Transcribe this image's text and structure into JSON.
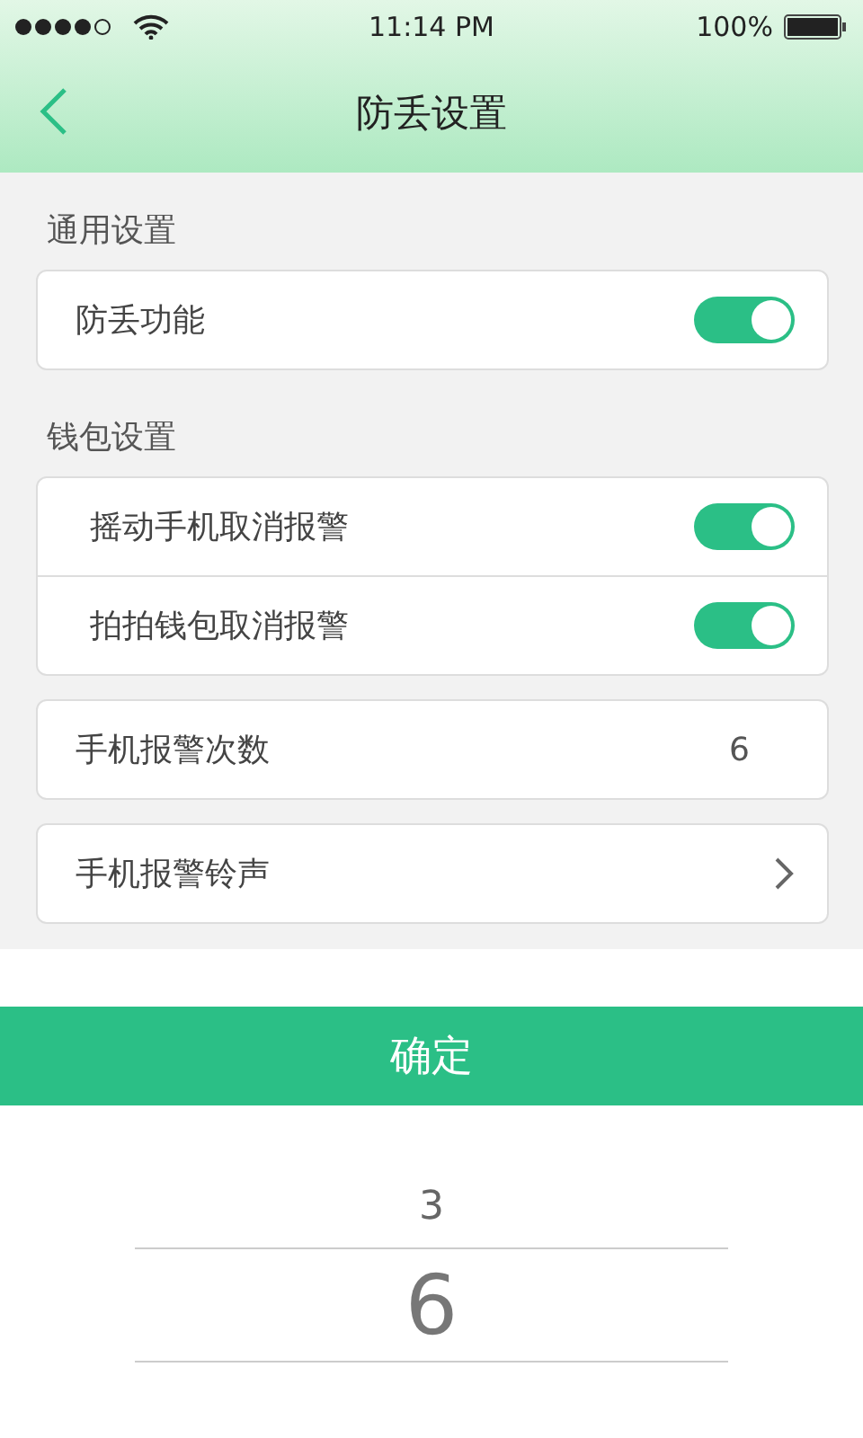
{
  "status_bar": {
    "time": "11:14 PM",
    "battery": "100%"
  },
  "nav": {
    "title": "防丢设置"
  },
  "sections": [
    {
      "label": "通用设置",
      "cards": [
        [
          {
            "kind": "toggle",
            "label": "防丢功能",
            "on": true
          }
        ]
      ]
    },
    {
      "label": "钱包设置",
      "cards": [
        [
          {
            "kind": "toggle",
            "label": "摇动手机取消报警",
            "on": true
          },
          {
            "kind": "toggle",
            "label": "拍拍钱包取消报警",
            "on": true
          }
        ],
        [
          {
            "kind": "value",
            "label": "手机报警次数",
            "value": "6"
          }
        ],
        [
          {
            "kind": "link",
            "label": "手机报警铃声"
          }
        ]
      ]
    }
  ],
  "confirm_button": "确定",
  "picker": [
    {
      "label": "3",
      "selected": false
    },
    {
      "label": "6",
      "selected": true
    }
  ]
}
